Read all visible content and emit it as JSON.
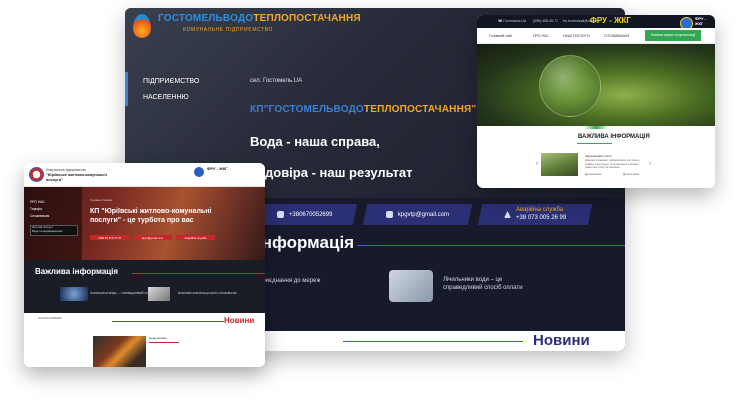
{
  "main_site": {
    "brand_blue": "ГОСТОМЕЛЬВОДО",
    "brand_orange": "ТЕПЛОПОСТАЧАННЯ",
    "brand_sub": "КОМУНАЛЬНЕ ПІДПРИЄМСТВО",
    "nav": [
      "ПІДПРИЄМСТВО",
      "НАСЕЛЕННЮ"
    ],
    "domain": "сел. Гостомель.UA",
    "headline_blue": "КП\"ГОСТОМЕЛЬВОДО",
    "headline_orange": "ТЕПЛОПОСТАЧАННЯ\"",
    "slogan_line1": "Вода - наша справа,",
    "slogan_line2": "довіра - наш результат",
    "phone": "+380670052699",
    "email": "kpgvtp@gmail.com",
    "emergency_label": "Аварійна служба",
    "emergency_phone": "+38 073 005 26 99",
    "info_title": "Інформація",
    "card1_text": "Приєднання до мереж",
    "card2_line1": "Лічильники води – це",
    "card2_line2": "справедливий спосіб оплати",
    "news_title": "Новини"
  },
  "fru_site": {
    "top_phone": "☎ Гостомель.UA",
    "top_phone2": "(095) 455-46-77",
    "top_email": "fru.kommunal@ukr.net",
    "fru_label": "ФРУ - ЖКГ",
    "badge_label": "ФРУ - ЖКГ",
    "nav": [
      "Головний сайт",
      "ПРО НАС",
      "НАШІ ПОСЛУГИ",
      "СПОЖИВАЧАМ"
    ],
    "cta": "Новини сфері та пропозиції",
    "info_title": "ВАЖЛИВА ІНФОРМАЦІЯ",
    "news_label": "Інформаційні листи",
    "news_body": "Шановні споживачі, повідомляємо про зміни у графіку подачі води та проведення планових ремонтних робіт на мережах.",
    "more": "Детальніше",
    "more2": "Детальніше"
  },
  "yurivka_site": {
    "org_top": "Комунальне підприємство",
    "org_name": "\"Юріївське житлово-комунальні послуги\"",
    "fru": "ФРУ - ЖКГ",
    "menu": [
      "ПРО НАС",
      "Тарифи",
      "Споживачам"
    ],
    "menu_box1": "Житлові послуги",
    "menu_box2": "Вода та водовідведення",
    "small_label": "Головна сторінка",
    "hero_title": "КП \"Юріївські житлово-комунальні послуги\" - це турбота про вас",
    "buttons": [
      "+380 67 675 77 57",
      "kp.ju@gmail.com",
      "Аварійна служба"
    ],
    "info_title": "Важлива інформація",
    "cap1": "ЛІЧИЛЬНИКИ ВОДИ — СПРАВЕДЛИВИЙ СПОСІБ ОПЛАТИ",
    "cap2": "ВАЖЛИВА ІНФОРМАЦІЯ ДЛЯ СПОЖИВАЧІВ",
    "section_small": "ОСТАННІ НОВИНИ",
    "news_title": "Новини",
    "news_text": "Нова новина"
  },
  "colors": {
    "main_blue": "#3a7fd9",
    "main_orange": "#f2a823",
    "main_navy": "#2b2f73",
    "fru_green": "#33a852",
    "yurivka_red": "#c8272a"
  }
}
